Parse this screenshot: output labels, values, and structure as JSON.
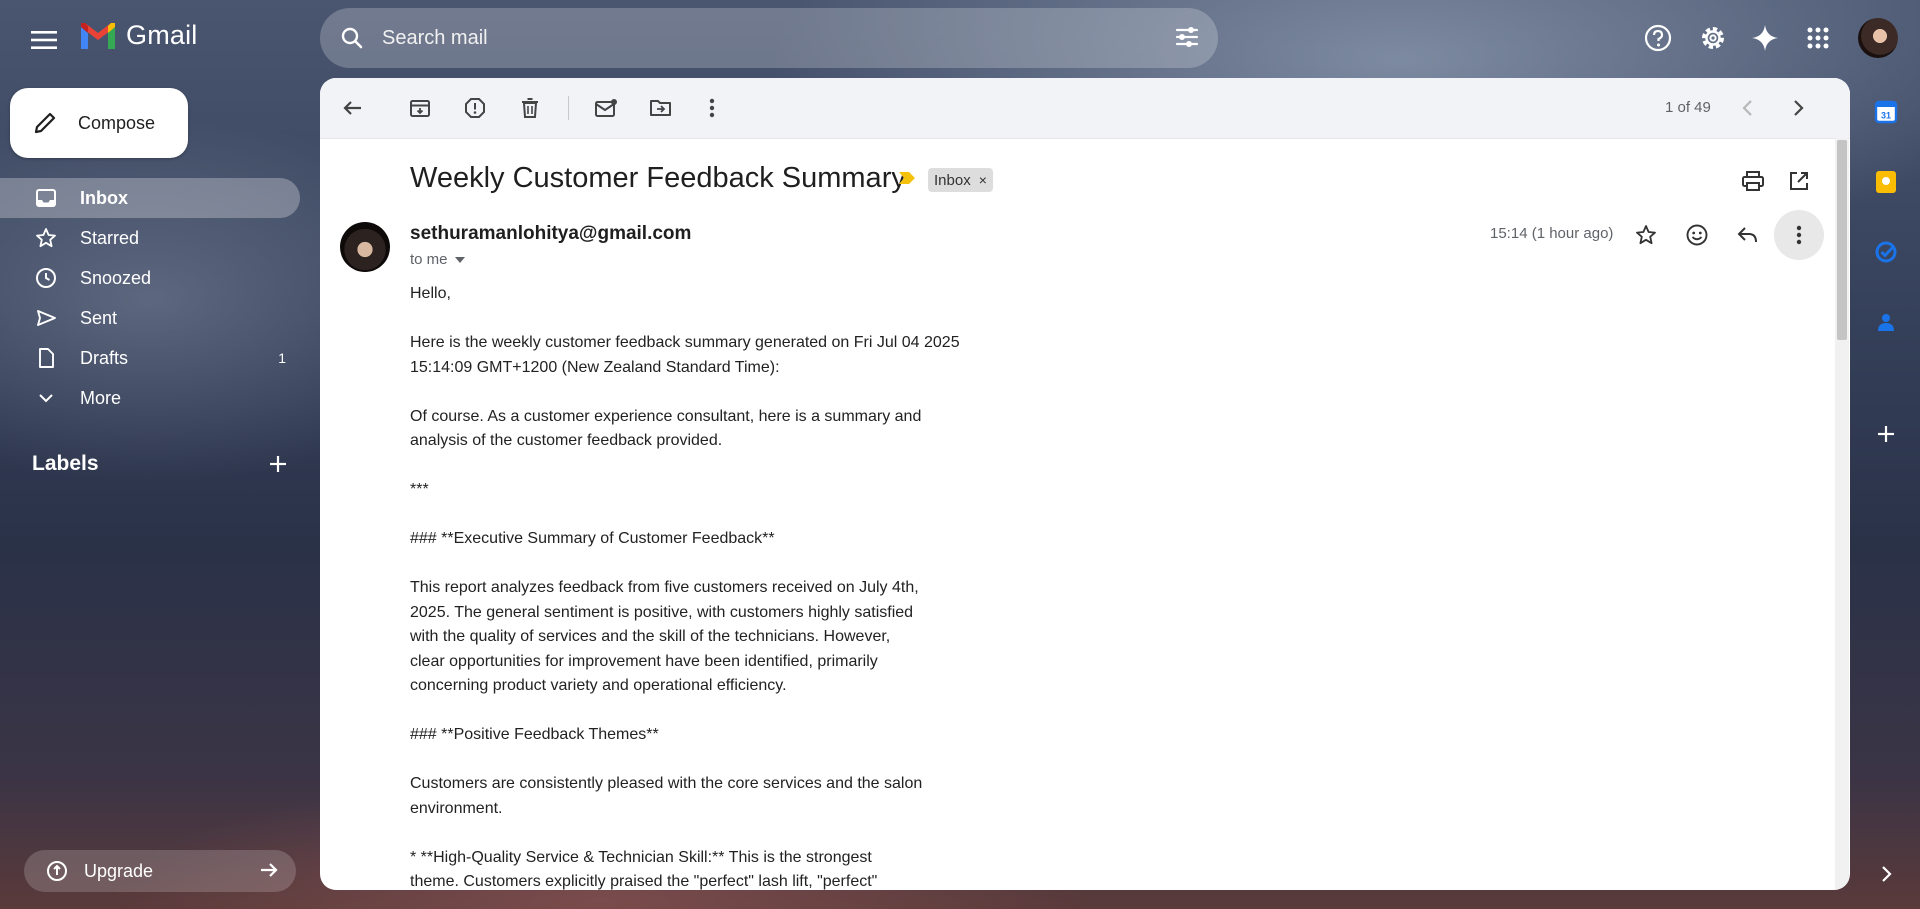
{
  "header": {
    "app_name": "Gmail",
    "search_placeholder": "Search mail"
  },
  "sidebar": {
    "compose_label": "Compose",
    "items": [
      {
        "label": "Inbox",
        "icon": "inbox-icon",
        "active": true,
        "count": ""
      },
      {
        "label": "Starred",
        "icon": "star-icon",
        "active": false,
        "count": ""
      },
      {
        "label": "Snoozed",
        "icon": "clock-icon",
        "active": false,
        "count": ""
      },
      {
        "label": "Sent",
        "icon": "send-icon",
        "active": false,
        "count": ""
      },
      {
        "label": "Drafts",
        "icon": "draft-icon",
        "active": false,
        "count": "1"
      },
      {
        "label": "More",
        "icon": "chevron-down-icon",
        "active": false,
        "count": ""
      }
    ],
    "labels_heading": "Labels",
    "upgrade_label": "Upgrade"
  },
  "toolbar": {
    "pager": "1 of 49"
  },
  "email": {
    "subject": "Weekly Customer Feedback Summary",
    "label_chip": "Inbox",
    "label_chip_close": "×",
    "sender": "sethuramanlohitya@gmail.com",
    "to": "to me",
    "timestamp": "15:14 (1 hour ago)",
    "body": [
      "Hello,",
      "Here is the weekly customer feedback summary generated on Fri Jul 04 2025\n15:14:09 GMT+1200 (New Zealand Standard Time):",
      "Of course. As a customer experience consultant, here is a summary and\nanalysis of the customer feedback provided.",
      "***",
      "### **Executive Summary of Customer Feedback**",
      "This report analyzes feedback from five customers received on July 4th,\n2025. The general sentiment is positive, with customers highly satisfied\nwith the quality of services and the skill of the technicians. However,\nclear opportunities for improvement have been identified, primarily\nconcerning product variety and operational efficiency.",
      "### **Positive Feedback Themes**",
      "Customers are consistently pleased with the core services and the salon\nenvironment.",
      "*   **High-Quality Service & Technician Skill:** This is the strongest\ntheme. Customers explicitly praised the \"perfect\" lash lift, \"perfect\""
    ]
  },
  "colors": {
    "accent_yellow": "#f4c20d",
    "panel_bg": "#ffffff",
    "toolbar_bg": "#f2f3f7"
  }
}
